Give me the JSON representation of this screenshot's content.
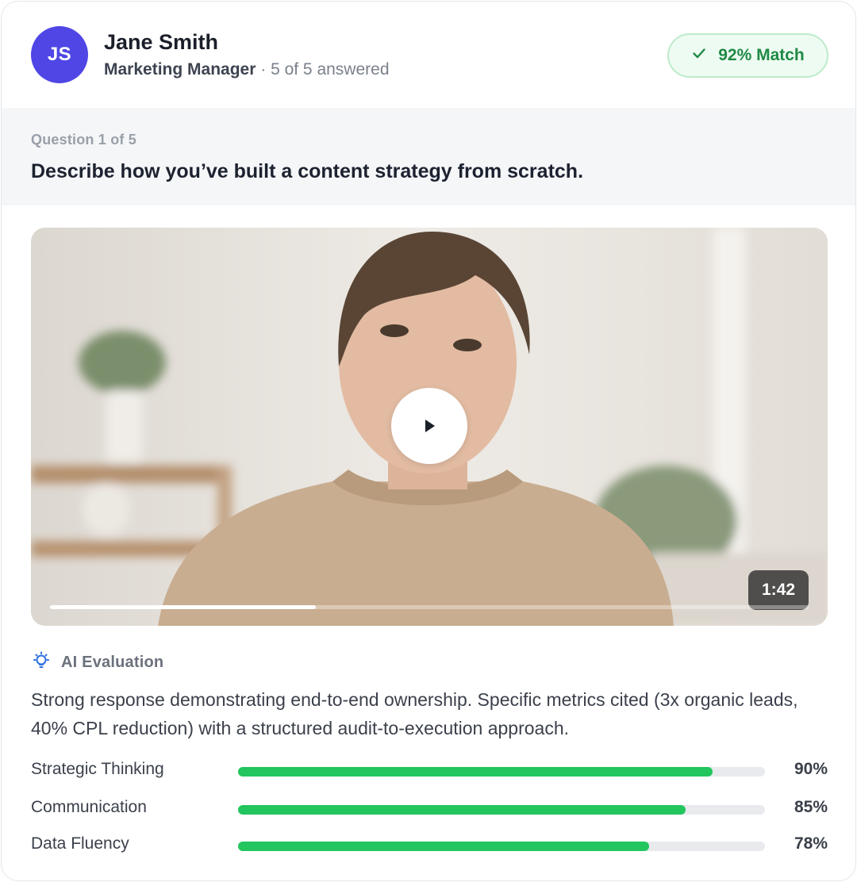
{
  "candidate": {
    "initials": "JS",
    "name": "Jane Smith",
    "role": "Marketing Manager",
    "separator": " · ",
    "progress_text": "5 of 5 answered",
    "avatar_color": "#4f46e5"
  },
  "match_badge": {
    "label": "92% Match",
    "icon": "check-icon",
    "text_color": "#1f8a45"
  },
  "question": {
    "counter": "Question 1 of 5",
    "text": "Describe how you’ve built a content strategy from scratch."
  },
  "video": {
    "duration": "1:42",
    "progress_fraction": 0.35,
    "play_icon": "play-icon"
  },
  "ai_evaluation": {
    "title": "AI Evaluation",
    "icon": "lightbulb-icon",
    "icon_color": "#2f6fe0",
    "summary": "Strong response demonstrating end-to-end ownership. Specific metrics cited (3x organic leads, 40% CPL reduction) with a structured audit-to-execution approach."
  },
  "metrics": [
    {
      "label": "Strategic Thinking",
      "value": 90,
      "display": "90%"
    },
    {
      "label": "Communication",
      "value": 85,
      "display": "85%"
    },
    {
      "label": "Data Fluency",
      "value": 78,
      "display": "78%"
    }
  ],
  "colors": {
    "bar_fill": "#22c55e"
  }
}
